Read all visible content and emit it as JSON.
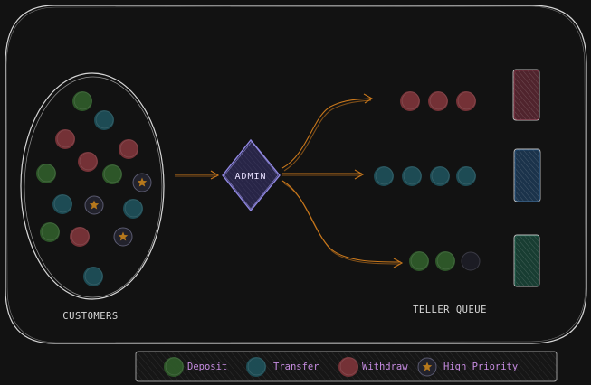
{
  "colors": {
    "background": "#121212",
    "outline": "#d6d6d6",
    "arrow": "#c9781c",
    "deposit": "#2f5a2a",
    "transfer": "#1e4f58",
    "withdraw": "#7a3338",
    "priority_star": "#b6781c",
    "admin_fill": "#3a3572",
    "admin_stroke": "#8f86e0",
    "legend_text": "#c58be0",
    "teller_withdraw": "#7a3040",
    "teller_transfer": "#214a72",
    "teller_deposit": "#1d5a48"
  },
  "customers_label": "CUSTOMERS",
  "admin_label": "ADMIN",
  "teller_queue_label": "TELLER QUEUE",
  "legend": {
    "items": [
      {
        "label": "Deposit",
        "kind": "deposit"
      },
      {
        "label": "Transfer",
        "kind": "transfer"
      },
      {
        "label": "Withdraw",
        "kind": "withdraw"
      },
      {
        "label": "High Priority",
        "kind": "priority"
      }
    ]
  },
  "customers": [
    {
      "kind": "deposit"
    },
    {
      "kind": "transfer"
    },
    {
      "kind": "withdraw"
    },
    {
      "kind": "withdraw"
    },
    {
      "kind": "withdraw"
    },
    {
      "kind": "deposit"
    },
    {
      "kind": "deposit"
    },
    {
      "kind": "priority"
    },
    {
      "kind": "transfer"
    },
    {
      "kind": "priority"
    },
    {
      "kind": "transfer"
    },
    {
      "kind": "deposit"
    },
    {
      "kind": "withdraw"
    },
    {
      "kind": "priority"
    },
    {
      "kind": "transfer"
    }
  ],
  "queues": [
    {
      "name": "withdraw",
      "items": [
        "withdraw",
        "withdraw",
        "withdraw"
      ],
      "teller": "teller_withdraw"
    },
    {
      "name": "transfer",
      "items": [
        "transfer",
        "transfer",
        "transfer",
        "transfer"
      ],
      "teller": "teller_transfer"
    },
    {
      "name": "deposit",
      "items": [
        "deposit",
        "deposit",
        "empty"
      ],
      "teller": "teller_deposit"
    }
  ]
}
